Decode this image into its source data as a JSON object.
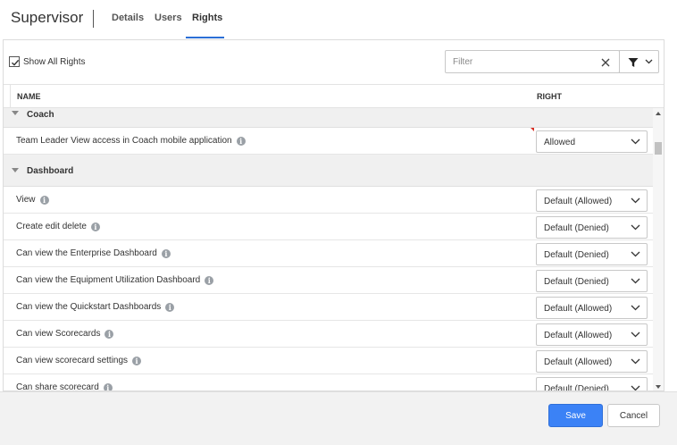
{
  "header": {
    "title": "Supervisor",
    "tabs": [
      {
        "label": "Details",
        "active": false
      },
      {
        "label": "Users",
        "active": false
      },
      {
        "label": "Rights",
        "active": true
      }
    ]
  },
  "toolbar": {
    "show_all_label": "Show All Rights",
    "show_all_checked": true,
    "filter_placeholder": "Filter",
    "clear_icon": "close-icon",
    "filter_icon": "funnel-icon"
  },
  "table": {
    "col_name": "NAME",
    "col_right": "RIGHT"
  },
  "groups": {
    "coach": {
      "label": "Coach",
      "rows": [
        {
          "label": "Team Leader View access in Coach mobile application",
          "value": "Allowed"
        }
      ]
    },
    "dashboard": {
      "label": "Dashboard",
      "rows": [
        {
          "label": "View",
          "value": "Default (Allowed)"
        },
        {
          "label": "Create edit delete",
          "value": "Default (Denied)"
        },
        {
          "label": "Can view the Enterprise Dashboard",
          "value": "Default (Denied)"
        },
        {
          "label": "Can view the Equipment Utilization Dashboard",
          "value": "Default (Denied)"
        },
        {
          "label": "Can view the Quickstart Dashboards",
          "value": "Default (Allowed)"
        },
        {
          "label": "Can view Scorecards",
          "value": "Default (Allowed)"
        },
        {
          "label": "Can view scorecard settings",
          "value": "Default (Allowed)"
        },
        {
          "label": "Can share scorecard",
          "value": "Default (Denied)"
        }
      ]
    }
  },
  "info_glyph": "i",
  "footer": {
    "save_label": "Save",
    "cancel_label": "Cancel"
  },
  "colors": {
    "accent": "#3b82f6",
    "tab_underline": "#2b6fd6",
    "group_bg": "#f0f0f0"
  }
}
